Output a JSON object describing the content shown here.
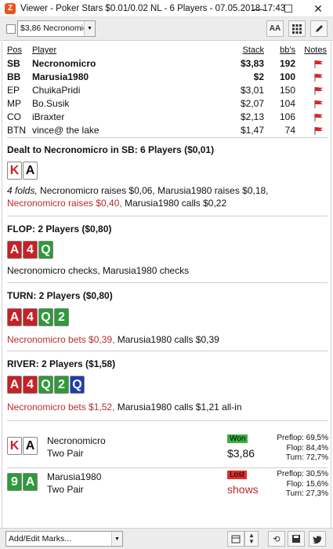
{
  "window": {
    "title": "Viewer - Poker Stars $0.01/0.02 NL - 6 Players - 07.05.2018 17:43",
    "app_icon": "Z",
    "minimize": "—",
    "maximize": "☐",
    "close": "✕"
  },
  "toolbar": {
    "hand_select_value": "$3,86 Necronomic",
    "font_button_label": "AA"
  },
  "players_table": {
    "headers": {
      "pos": "Pos",
      "player": "Player",
      "stack": "Stack",
      "bbs": "bb's",
      "notes": "Notes"
    },
    "rows": [
      {
        "pos": "SB",
        "player": "Necronomicro",
        "stack": "$3,83",
        "bbs": "192",
        "bold": true
      },
      {
        "pos": "BB",
        "player": "Marusia1980",
        "stack": "$2",
        "bbs": "100",
        "bold": true
      },
      {
        "pos": "EP",
        "player": "ChuikaPridi",
        "stack": "$3,01",
        "bbs": "150",
        "bold": false
      },
      {
        "pos": "MP",
        "player": "Bo.Susik",
        "stack": "$2,07",
        "bbs": "104",
        "bold": false
      },
      {
        "pos": "CO",
        "player": "iBraxter",
        "stack": "$2,13",
        "bbs": "106",
        "bold": false
      },
      {
        "pos": "BTN",
        "player": "vince@ the lake",
        "stack": "$1,47",
        "bbs": "74",
        "bold": false
      }
    ],
    "flag_color": "#d22"
  },
  "preflop": {
    "title": "Dealt to Necronomicro in SB: 6 Players ($0,01)",
    "cards": [
      "K",
      "A"
    ],
    "action_folds": "4 folds,",
    "action_1": " Necronomicro raises $0,06, Marusia1980 raises $0,18, ",
    "action_red": "Necronomicro raises $0,40,",
    "action_2": " Marusia1980 calls $0,22"
  },
  "flop": {
    "title": "FLOP: 2 Players ($0,80)",
    "cards": [
      "A",
      "4",
      "Q"
    ],
    "action": "Necronomicro checks, Marusia1980 checks"
  },
  "turn": {
    "title": "TURN: 2 Players ($0,80)",
    "cards": [
      "A",
      "4",
      "Q",
      "2"
    ],
    "action_red": "Necronomicro bets $0,39,",
    "action": " Marusia1980 calls $0,39"
  },
  "river": {
    "title": "RIVER: 2 Players ($1,58)",
    "cards": [
      "A",
      "4",
      "Q",
      "2",
      "Q"
    ],
    "action_red": "Necronomicro bets $1,52,",
    "action": " Marusia1980 calls $1,21 all-in"
  },
  "results": [
    {
      "cards": [
        "K",
        "A"
      ],
      "name": "Necronomicro",
      "hand": "Two Pair",
      "badge": "Won",
      "amount": "$3,86",
      "stats": [
        {
          "label": "Preflop:",
          "value": "69,5%"
        },
        {
          "label": "Flop:",
          "value": "84,4%"
        },
        {
          "label": "Turn:",
          "value": "72,7%"
        }
      ]
    },
    {
      "cards": [
        "9",
        "A"
      ],
      "name": "Marusia1980",
      "hand": "Two Pair",
      "badge": "Lost",
      "amount": "shows",
      "stats": [
        {
          "label": "Preflop:",
          "value": "30,5%"
        },
        {
          "label": "Flop:",
          "value": "15,6%"
        },
        {
          "label": "Turn:",
          "value": "27,3%"
        }
      ]
    }
  ],
  "bottombar": {
    "marks_select_value": "Add/Edit Marks...",
    "colors": {
      "won": "#3cb043",
      "lost": "#d9302c",
      "red_text": "#b82c2c"
    }
  }
}
